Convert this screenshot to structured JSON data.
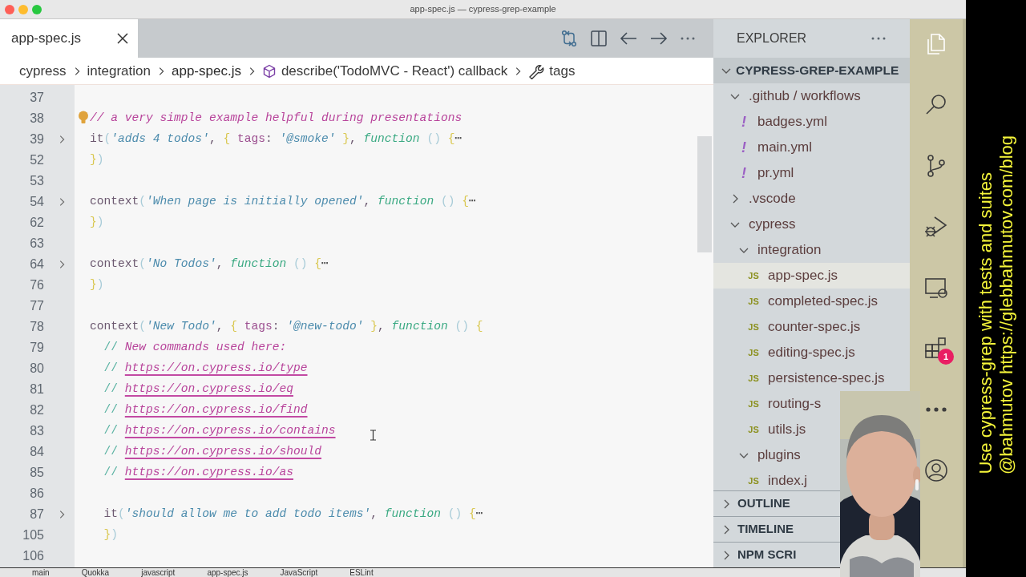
{
  "window": {
    "title": "app-spec.js — cypress-grep-example"
  },
  "tabs": [
    {
      "label": "app-spec.js",
      "selected": true
    }
  ],
  "breadcrumb": [
    {
      "kind": "folder",
      "text": "cypress"
    },
    {
      "kind": "folder",
      "text": "integration"
    },
    {
      "kind": "file",
      "text": "app-spec.js"
    },
    {
      "kind": "method",
      "text": "describe('TodoMVC - React') callback"
    },
    {
      "kind": "property",
      "text": "tags"
    }
  ],
  "editor": {
    "lines": [
      {
        "number": "37",
        "folded": false,
        "lightbulb": false
      },
      {
        "number": "38",
        "folded": false,
        "lightbulb": true,
        "tokens": [
          {
            "kind": "comment",
            "text": "// a very simple example helpful during presentations"
          }
        ]
      },
      {
        "number": "39",
        "folded": true,
        "lightbulb": false,
        "tokens": [
          {
            "kind": "plain",
            "text": "it"
          },
          {
            "kind": "paren",
            "text": "("
          },
          {
            "kind": "string",
            "text": "'adds 4 todos'"
          },
          {
            "kind": "plain",
            "text": ", "
          },
          {
            "kind": "brace",
            "text": "{ "
          },
          {
            "kind": "property",
            "text": "tags"
          },
          {
            "kind": "plain",
            "text": ": "
          },
          {
            "kind": "string",
            "text": "'@smoke'"
          },
          {
            "kind": "brace",
            "text": " }"
          },
          {
            "kind": "plain",
            "text": ", "
          },
          {
            "kind": "keyword",
            "text": "function"
          },
          {
            "kind": "paren",
            "text": " ()"
          },
          {
            "kind": "brace",
            "text": " {"
          },
          {
            "kind": "ellipsis",
            "text": "⋯"
          }
        ]
      },
      {
        "number": "52",
        "folded": false,
        "lightbulb": false,
        "tokens": [
          {
            "kind": "brace",
            "text": "}"
          },
          {
            "kind": "paren",
            "text": ")"
          }
        ]
      },
      {
        "number": "53",
        "folded": false,
        "lightbulb": false
      },
      {
        "number": "54",
        "folded": true,
        "lightbulb": false,
        "tokens": [
          {
            "kind": "plain",
            "text": "context"
          },
          {
            "kind": "paren",
            "text": "("
          },
          {
            "kind": "string",
            "text": "'When page is initially opened'"
          },
          {
            "kind": "plain",
            "text": ", "
          },
          {
            "kind": "keyword",
            "text": "function"
          },
          {
            "kind": "paren",
            "text": " ()"
          },
          {
            "kind": "brace",
            "text": " {"
          },
          {
            "kind": "ellipsis",
            "text": "⋯"
          }
        ]
      },
      {
        "number": "62",
        "folded": false,
        "lightbulb": false,
        "tokens": [
          {
            "kind": "brace",
            "text": "}"
          },
          {
            "kind": "paren",
            "text": ")"
          }
        ]
      },
      {
        "number": "63",
        "folded": false,
        "lightbulb": false
      },
      {
        "number": "64",
        "folded": true,
        "lightbulb": false,
        "tokens": [
          {
            "kind": "plain",
            "text": "context"
          },
          {
            "kind": "paren",
            "text": "("
          },
          {
            "kind": "string",
            "text": "'No Todos'"
          },
          {
            "kind": "plain",
            "text": ", "
          },
          {
            "kind": "keyword",
            "text": "function"
          },
          {
            "kind": "paren",
            "text": " ()"
          },
          {
            "kind": "brace",
            "text": " {"
          },
          {
            "kind": "ellipsis",
            "text": "⋯"
          }
        ]
      },
      {
        "number": "76",
        "folded": false,
        "lightbulb": false,
        "tokens": [
          {
            "kind": "brace",
            "text": "}"
          },
          {
            "kind": "paren",
            "text": ")"
          }
        ]
      },
      {
        "number": "77",
        "folded": false,
        "lightbulb": false
      },
      {
        "number": "78",
        "folded": false,
        "lightbulb": false,
        "tokens": [
          {
            "kind": "plain",
            "text": "context"
          },
          {
            "kind": "paren",
            "text": "("
          },
          {
            "kind": "string",
            "text": "'New Todo'"
          },
          {
            "kind": "plain",
            "text": ", "
          },
          {
            "kind": "brace",
            "text": "{ "
          },
          {
            "kind": "property",
            "text": "tags"
          },
          {
            "kind": "plain",
            "text": ": "
          },
          {
            "kind": "string",
            "text": "'@new-todo'"
          },
          {
            "kind": "brace",
            "text": " }"
          },
          {
            "kind": "plain",
            "text": ", "
          },
          {
            "kind": "keyword",
            "text": "function"
          },
          {
            "kind": "paren",
            "text": " ()"
          },
          {
            "kind": "brace",
            "text": " {"
          }
        ]
      },
      {
        "number": "79",
        "folded": false,
        "lightbulb": false,
        "tokens": [
          {
            "kind": "comment-mark",
            "text": "  // "
          },
          {
            "kind": "comment",
            "text": "New commands used here:"
          }
        ]
      },
      {
        "number": "80",
        "folded": false,
        "lightbulb": false,
        "tokens": [
          {
            "kind": "comment-mark",
            "text": "  // "
          },
          {
            "kind": "link",
            "text": "https://on.cypress.io/type"
          }
        ]
      },
      {
        "number": "81",
        "folded": false,
        "lightbulb": false,
        "tokens": [
          {
            "kind": "comment-mark",
            "text": "  // "
          },
          {
            "kind": "link",
            "text": "https://on.cypress.io/eq"
          }
        ]
      },
      {
        "number": "82",
        "folded": false,
        "lightbulb": false,
        "tokens": [
          {
            "kind": "comment-mark",
            "text": "  // "
          },
          {
            "kind": "link",
            "text": "https://on.cypress.io/find"
          }
        ]
      },
      {
        "number": "83",
        "folded": false,
        "lightbulb": false,
        "tokens": [
          {
            "kind": "comment-mark",
            "text": "  // "
          },
          {
            "kind": "link",
            "text": "https://on.cypress.io/contains"
          }
        ]
      },
      {
        "number": "84",
        "folded": false,
        "lightbulb": false,
        "tokens": [
          {
            "kind": "comment-mark",
            "text": "  // "
          },
          {
            "kind": "link",
            "text": "https://on.cypress.io/should"
          }
        ]
      },
      {
        "number": "85",
        "folded": false,
        "lightbulb": false,
        "tokens": [
          {
            "kind": "comment-mark",
            "text": "  // "
          },
          {
            "kind": "link",
            "text": "https://on.cypress.io/as"
          }
        ]
      },
      {
        "number": "86",
        "folded": false,
        "lightbulb": false
      },
      {
        "number": "87",
        "folded": true,
        "lightbulb": false,
        "tokens": [
          {
            "kind": "plain",
            "text": "  it"
          },
          {
            "kind": "paren",
            "text": "("
          },
          {
            "kind": "string",
            "text": "'should allow me to add todo items'"
          },
          {
            "kind": "plain",
            "text": ", "
          },
          {
            "kind": "keyword",
            "text": "function"
          },
          {
            "kind": "paren",
            "text": " ()"
          },
          {
            "kind": "brace",
            "text": " {"
          },
          {
            "kind": "ellipsis",
            "text": "⋯"
          }
        ]
      },
      {
        "number": "105",
        "folded": false,
        "lightbulb": false,
        "tokens": [
          {
            "kind": "brace",
            "text": "  }"
          },
          {
            "kind": "paren",
            "text": ")"
          }
        ]
      },
      {
        "number": "106",
        "folded": false,
        "lightbulb": false
      }
    ]
  },
  "sidebar": {
    "title": "EXPLORER",
    "project": {
      "label": "CYPRESS-GREP-EXAMPLE",
      "expanded": true
    },
    "tree": [
      {
        "label": ".github / workflows",
        "kind": "folder",
        "expanded": true,
        "children": [
          {
            "label": "badges.yml",
            "kind": "file",
            "icon_text": "!",
            "selected": false
          },
          {
            "label": "main.yml",
            "kind": "file",
            "icon_text": "!",
            "selected": false
          },
          {
            "label": "pr.yml",
            "kind": "file",
            "icon_text": "!",
            "selected": false
          }
        ]
      },
      {
        "label": ".vscode",
        "kind": "folder",
        "expanded": false
      },
      {
        "label": "cypress",
        "kind": "folder",
        "expanded": true,
        "children": [
          {
            "label": "integration",
            "kind": "folder",
            "expanded": true,
            "children": [
              {
                "label": "app-spec.js",
                "kind": "file",
                "icon_text": "JS",
                "selected": true
              },
              {
                "label": "completed-spec.js",
                "kind": "file",
                "icon_text": "JS",
                "selected": false
              },
              {
                "label": "counter-spec.js",
                "kind": "file",
                "icon_text": "JS",
                "selected": false
              },
              {
                "label": "editing-spec.js",
                "kind": "file",
                "icon_text": "JS",
                "selected": false
              },
              {
                "label": "persistence-spec.js",
                "kind": "file",
                "icon_text": "JS",
                "selected": false
              },
              {
                "label": "routing-s",
                "kind": "file",
                "icon_text": "JS",
                "selected": false
              },
              {
                "label": "utils.js",
                "kind": "file",
                "icon_text": "JS",
                "selected": false
              }
            ]
          },
          {
            "label": "plugins",
            "kind": "folder",
            "expanded": true,
            "children": [
              {
                "label": "index.j",
                "kind": "file",
                "icon_text": "JS",
                "selected": false
              }
            ]
          }
        ]
      }
    ],
    "sections": [
      {
        "label": "OUTLINE",
        "expanded": false
      },
      {
        "label": "TIMELINE",
        "expanded": false
      },
      {
        "label": "NPM SCRI",
        "expanded": false
      }
    ]
  },
  "activity_bar": [
    {
      "kind": "files",
      "selected": true
    },
    {
      "kind": "search",
      "selected": false
    },
    {
      "kind": "source-control",
      "selected": false
    },
    {
      "kind": "run-debug",
      "selected": false
    },
    {
      "kind": "remote",
      "selected": false
    },
    {
      "kind": "extensions",
      "selected": false,
      "badge": "1"
    },
    {
      "kind": "more",
      "selected": false
    },
    {
      "kind": "account",
      "selected": false
    }
  ],
  "status_bar": [
    "main",
    "Quokka",
    "javascript",
    "app-spec.js",
    "JavaScript",
    "ESLint"
  ],
  "video_caption": [
    "Use cypress-grep with tests and suites",
    "@bahmutov https://glebbahmutov.com/blog"
  ],
  "webcam": {
    "kind": "picture"
  }
}
